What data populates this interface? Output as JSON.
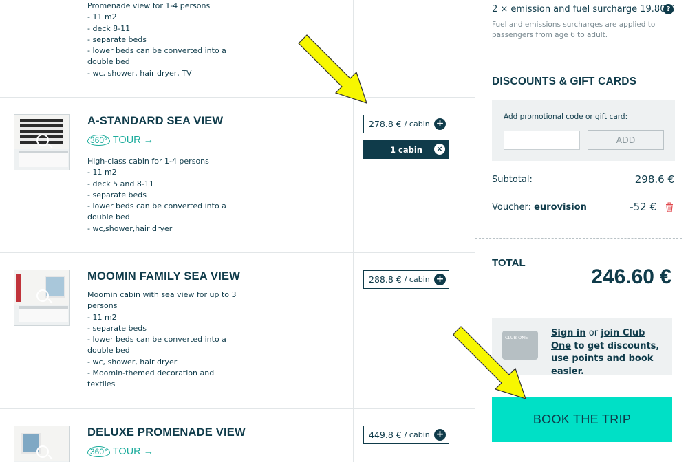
{
  "cabins": [
    {
      "title": "",
      "description_lines": [
        "Promenade view for 1-4 persons",
        "- 11 m2",
        "- deck 8-11",
        "- separate beds",
        "- lower beds can be converted into a",
        "double bed",
        "- wc, shower, hair dryer, TV"
      ]
    },
    {
      "title": "A-STANDARD SEA VIEW",
      "tour_360": "360°",
      "tour_label": "TOUR →",
      "price": "278.8 €",
      "price_unit": "/ cabin",
      "selected_label": "1 cabin",
      "description_lines": [
        "High-class cabin for 1-4 persons",
        "- 11 m2",
        "- deck 5 and 8-11",
        "- separate beds",
        "- lower beds can be converted into a",
        "double bed",
        "- wc,shower,hair dryer"
      ]
    },
    {
      "title": "MOOMIN FAMILY SEA VIEW",
      "price": "288.8 €",
      "price_unit": "/ cabin",
      "description_lines": [
        "Moomin cabin with sea view for up to 3",
        "persons",
        "- 11 m2",
        "- separate beds",
        "- lower beds can be converted into a",
        "double bed",
        "- wc, shower, hair dryer",
        "- Moomin-themed decoration and",
        "textiles"
      ]
    },
    {
      "title": "DELUXE PROMENADE VIEW",
      "tour_360": "360°",
      "tour_label": "TOUR →",
      "price": "449.8 €",
      "price_unit": "/ cabin"
    }
  ],
  "panel": {
    "surcharge_title": "2 × emission and fuel surcharge 19.80 €",
    "surcharge_note": "Fuel and emissions surcharges are applied to passengers from age 6 to adult.",
    "help_icon": "?",
    "discounts_title": "DISCOUNTS & GIFT CARDS",
    "promo_label": "Add promotional code or gift card:",
    "promo_value": "",
    "promo_add": "ADD",
    "subtotal_label": "Subtotal:",
    "subtotal_value": "298.6 €",
    "voucher_label": "Voucher:",
    "voucher_code": "eurovision",
    "voucher_value": "-52 €",
    "total_label": "TOTAL",
    "total_value": "246.60 €",
    "club_card_label": "CLUB ONE",
    "club_sign_in": "Sign in",
    "club_or": "or",
    "club_join": "join Club One",
    "club_rest": "to get discounts, use points and book easier.",
    "book_button": "BOOK THE TRIP"
  },
  "colors": {
    "primary": "#0f3b4a",
    "accent_button": "#00e0c6",
    "tour_green": "#1aab9b",
    "annotation_arrow": "#f7f700",
    "trash_red": "#e0484d"
  }
}
